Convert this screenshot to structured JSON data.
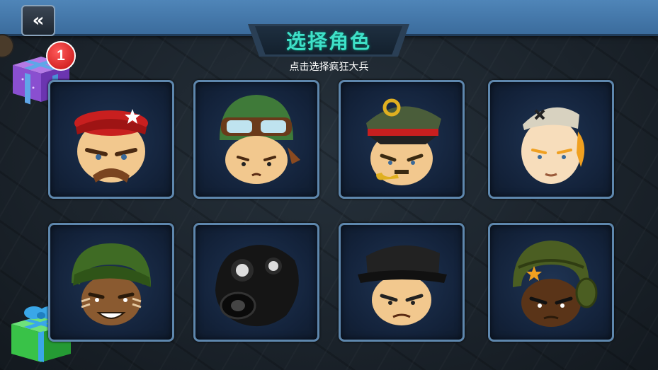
{
  "header": {
    "back_icon": "double-chevron-left-icon",
    "back_glyph": "«",
    "title": "选择角色",
    "subtitle": "点击选择疯狂大兵"
  },
  "gifts": [
    {
      "name": "gift-purple",
      "badge_count": "1",
      "color": "#8a4fd0"
    },
    {
      "name": "gift-green",
      "color": "#39c248"
    }
  ],
  "characters": [
    {
      "id": "red-beret-soldier",
      "hat_color": "#c81f1f"
    },
    {
      "id": "goggles-helmet-soldier",
      "hat_color": "#3f7a39"
    },
    {
      "id": "officer-with-pipe",
      "hat_color": "#4a5d3a"
    },
    {
      "id": "garrison-cap-soldier",
      "hat_color": "#d8d2c0"
    },
    {
      "id": "green-helmet-soldier",
      "hat_color": "#3f6b24"
    },
    {
      "id": "gas-mask-soldier",
      "hat_color": "#111111"
    },
    {
      "id": "black-cap-soldier",
      "hat_color": "#222222"
    },
    {
      "id": "tanker-helmet-soldier",
      "hat_color": "#4b5e22"
    }
  ],
  "colors": {
    "title_text": "#3fe0c8",
    "top_bar": "#4a80b3",
    "card_border": "#5e87ad"
  }
}
